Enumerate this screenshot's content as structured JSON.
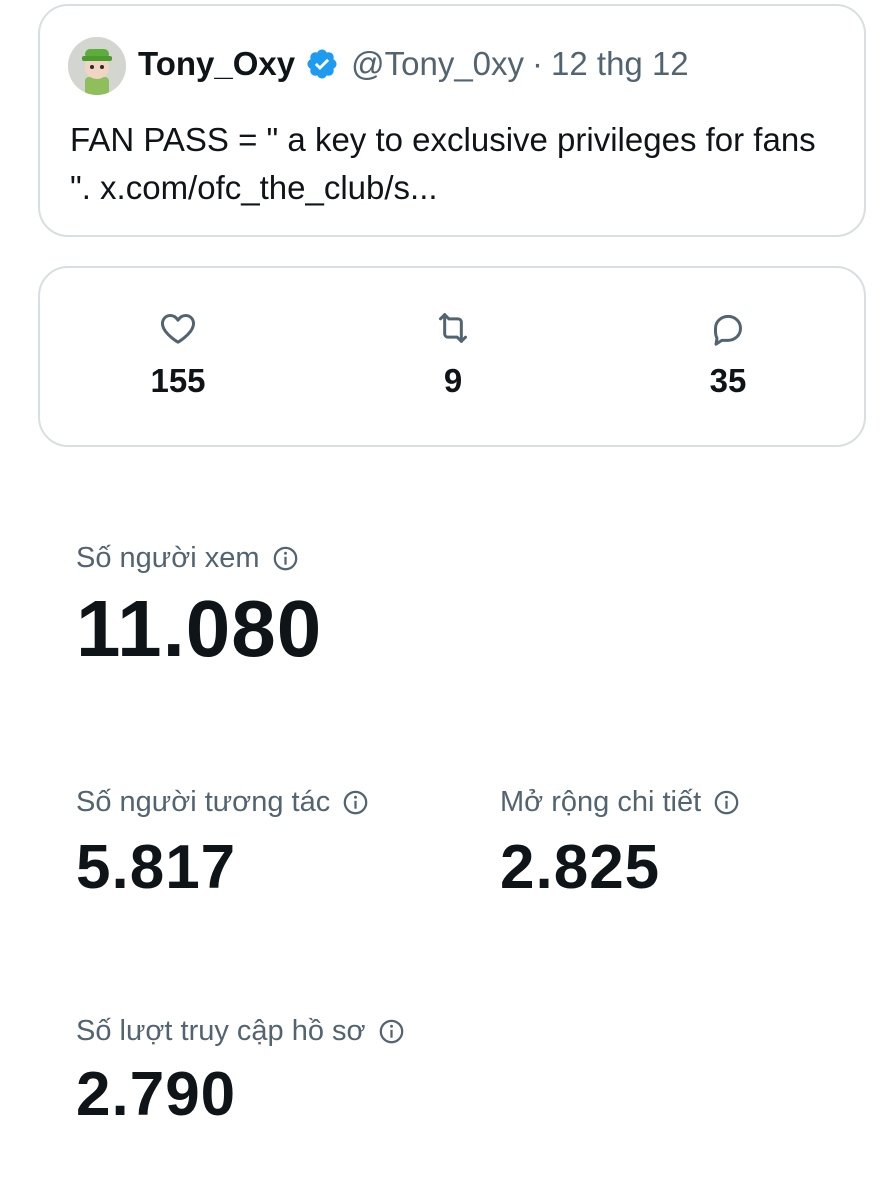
{
  "tweet": {
    "author_name": "Tony_Oxy",
    "verified": true,
    "handle": "@Tony_0xy",
    "separator": "·",
    "date": "12 thg 12",
    "text": "FAN PASS = \" a key to exclusive privileges for fans \". x.com/ofc_the_club/s...",
    "avatar_icon": "avatar-cartoon-green-cap"
  },
  "engagement": {
    "likes": {
      "icon": "heart-icon",
      "count": "155"
    },
    "reposts": {
      "icon": "repost-icon",
      "count": "9"
    },
    "replies": {
      "icon": "reply-icon",
      "count": "35"
    }
  },
  "metrics": {
    "views": {
      "label": "Số người xem",
      "value": "11.080"
    },
    "engagements": {
      "label": "Số người tương tác",
      "value": "5.817"
    },
    "detail_expands": {
      "label": "Mở rộng chi tiết",
      "value": "2.825"
    },
    "profile_visits": {
      "label": "Số lượt truy cập hồ sơ",
      "value": "2.790"
    }
  },
  "colors": {
    "text_primary": "#0f1419",
    "text_secondary": "#536471",
    "border": "#d9dee2",
    "verified_blue": "#1d9bf0"
  }
}
